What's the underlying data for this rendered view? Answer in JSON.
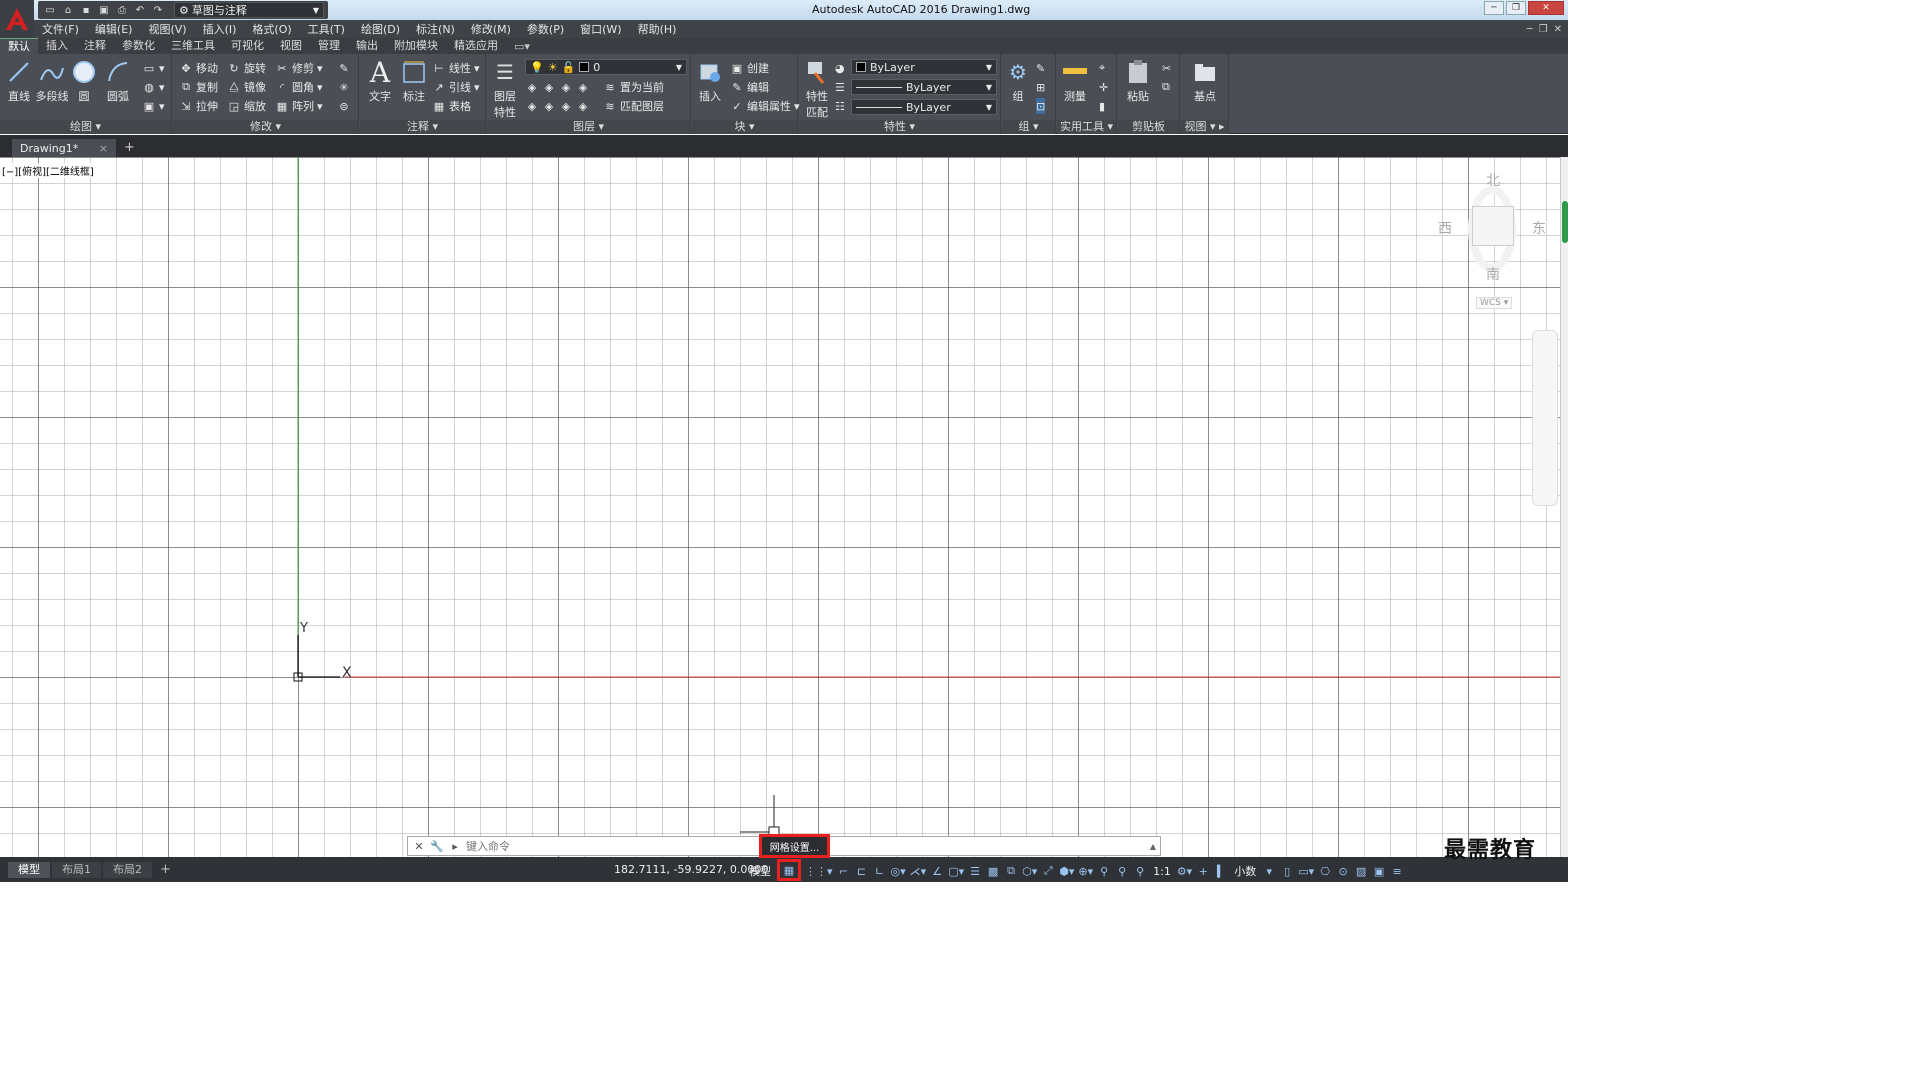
{
  "app": {
    "title": "Autodesk AutoCAD 2016    Drawing1.dwg",
    "workspace": "草图与注释"
  },
  "menubar": [
    "文件(F)",
    "编辑(E)",
    "视图(V)",
    "插入(I)",
    "格式(O)",
    "工具(T)",
    "绘图(D)",
    "标注(N)",
    "修改(M)",
    "参数(P)",
    "窗口(W)",
    "帮助(H)"
  ],
  "ribbon_tabs": [
    "默认",
    "插入",
    "注释",
    "参数化",
    "三维工具",
    "可视化",
    "视图",
    "管理",
    "输出",
    "附加模块",
    "精选应用"
  ],
  "ribbon": {
    "draw": {
      "title": "绘图",
      "line": "直线",
      "polyline": "多段线",
      "circle": "圆",
      "arc": "圆弧"
    },
    "modify": {
      "title": "修改",
      "move": "移动",
      "rotate": "旋转",
      "trim": "修剪",
      "copy": "复制",
      "mirror": "镜像",
      "fillet": "圆角",
      "stretch": "拉伸",
      "scale": "缩放",
      "array": "阵列"
    },
    "annotation": {
      "title": "注释",
      "text": "文字",
      "dimension": "标注",
      "linear": "线性",
      "leader": "引线",
      "table": "表格"
    },
    "layers": {
      "title": "图层",
      "layer_props": "图层\n特性",
      "layer_props_a": "图层",
      "layer_props_b": "特性",
      "current_layer": "0",
      "set_current": "置为当前",
      "match_layer": "匹配图层"
    },
    "block": {
      "title": "块",
      "insert": "插入",
      "create": "创建",
      "edit": "编辑",
      "edit_attr": "编辑属性"
    },
    "properties": {
      "title": "特性",
      "match_a": "特性",
      "match_b": "匹配",
      "color": "ByLayer",
      "linetype": "ByLayer",
      "lineweight": "ByLayer"
    },
    "groups": {
      "title": "组",
      "group": "组"
    },
    "utilities": {
      "title": "实用工具",
      "measure": "测量"
    },
    "clipboard": {
      "title": "剪贴板",
      "paste": "粘贴"
    },
    "view": {
      "title": "视图",
      "base": "基点"
    }
  },
  "file_tab": {
    "name": "Drawing1*",
    "close": "×",
    "add": "+"
  },
  "viewport": {
    "label": "[−][俯视][二维线框]",
    "ucs_x": "X",
    "ucs_y": "Y"
  },
  "viewcube": {
    "north": "北",
    "south": "南",
    "east": "东",
    "west": "西",
    "wcs": "WCS ▾"
  },
  "command": {
    "placeholder": "键入命令"
  },
  "tooltip": "网格设置...",
  "statusbar": {
    "layout_tabs": [
      "模型",
      "布局1",
      "布局2"
    ],
    "add": "+",
    "coords": "182.7111, -59.9227, 0.0000",
    "model": "模型",
    "scale": "1:1",
    "units": "小数"
  },
  "watermark": "最需教育",
  "colors": {
    "ribbon_bg": "#4b4f55",
    "dark_bg": "#2f3236",
    "highlight": "#e82020",
    "x_axis": "#d04040",
    "y_axis": "#40a040"
  }
}
